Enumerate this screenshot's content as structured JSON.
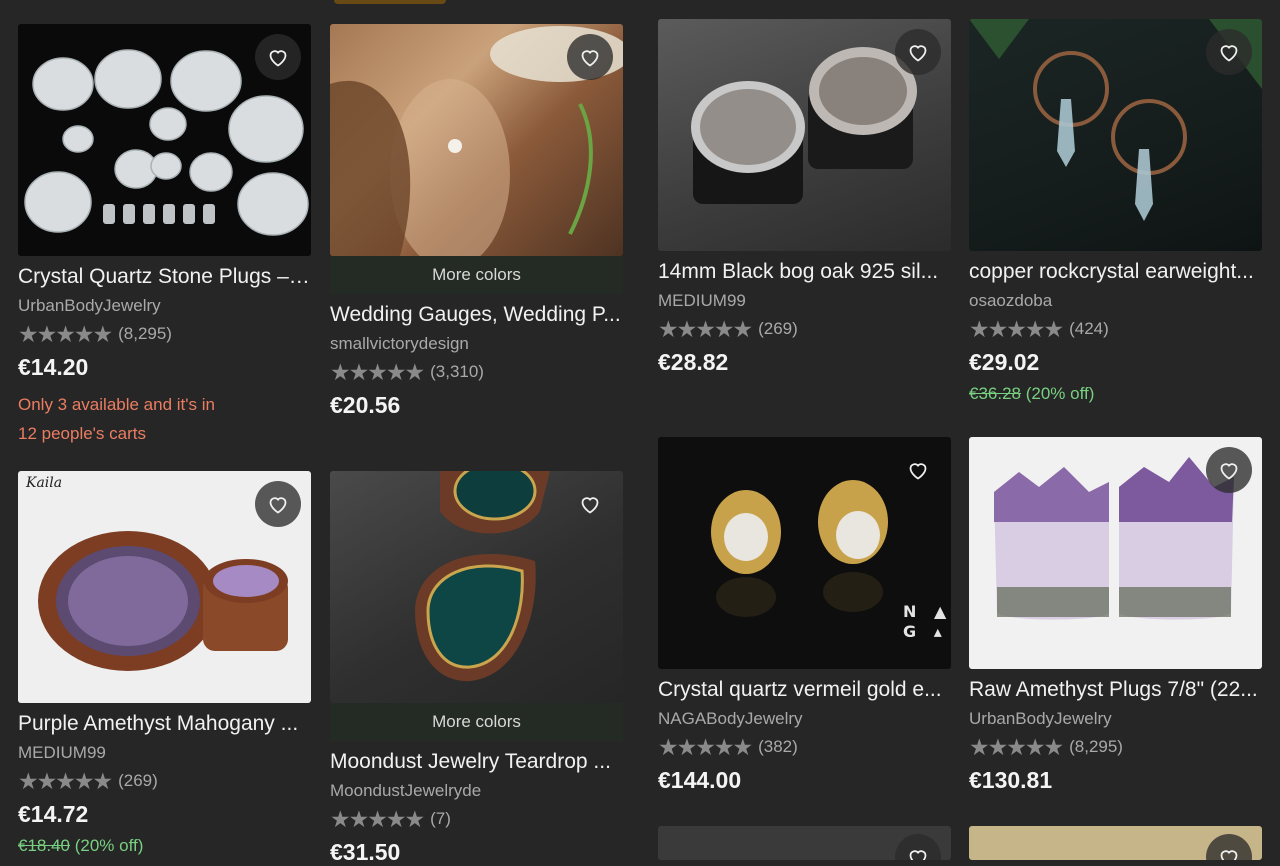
{
  "products": [
    {
      "title": "Crystal Quartz Stone Plugs – ...",
      "shop": "UrbanBodyJewelry",
      "stars": "★★★★★",
      "reviews": "(8,295)",
      "price": "€14.20",
      "scarcity_line1": "Only 3 available and it's in",
      "scarcity_line2": "12 people's carts"
    },
    {
      "more_colors": "More colors",
      "title": "Wedding Gauges, Wedding P...",
      "shop": "smallvictorydesign",
      "stars": "★★★★★",
      "reviews": "(3,310)",
      "price": "€20.56"
    },
    {
      "title": "14mm Black bog oak 925 sil...",
      "shop": "MEDIUM99",
      "stars": "★★★★★",
      "reviews": "(269)",
      "price": "€28.82"
    },
    {
      "title": "copper rockcrystal earweight...",
      "shop": "osaozdoba",
      "stars": "★★★★★",
      "reviews": "(424)",
      "price": "€29.02",
      "original_price": "€36.28",
      "discount": "(20% off)"
    },
    {
      "title": "Purple Amethyst Mahogany ...",
      "shop": "MEDIUM99",
      "stars": "★★★★★",
      "reviews": "(269)",
      "price": "€14.72",
      "original_price": "€18.40",
      "discount": "(20% off)"
    },
    {
      "more_colors": "More colors",
      "title": "Moondust Jewelry Teardrop ...",
      "shop": "MoondustJewelryde",
      "stars": "★★★★★",
      "reviews": "(7)",
      "price": "€31.50"
    },
    {
      "title": "Crystal quartz vermeil gold e...",
      "shop": "NAGABodyJewelry",
      "stars": "★★★★★",
      "reviews": "(382)",
      "price": "€144.00",
      "image_text": "N A G ▲"
    },
    {
      "title": "Raw Amethyst Plugs 7/8\" (22...",
      "shop": "UrbanBodyJewelry",
      "stars": "★★★★★",
      "reviews": "(8,295)",
      "price": "€130.81"
    }
  ],
  "colors": {
    "background": "#262626",
    "scarcity": "#ea7d62",
    "discount": "#78d080",
    "price": "#f4f4f4"
  },
  "icons": {
    "favorite": "heart-outline-icon",
    "rating": "star-icon"
  }
}
